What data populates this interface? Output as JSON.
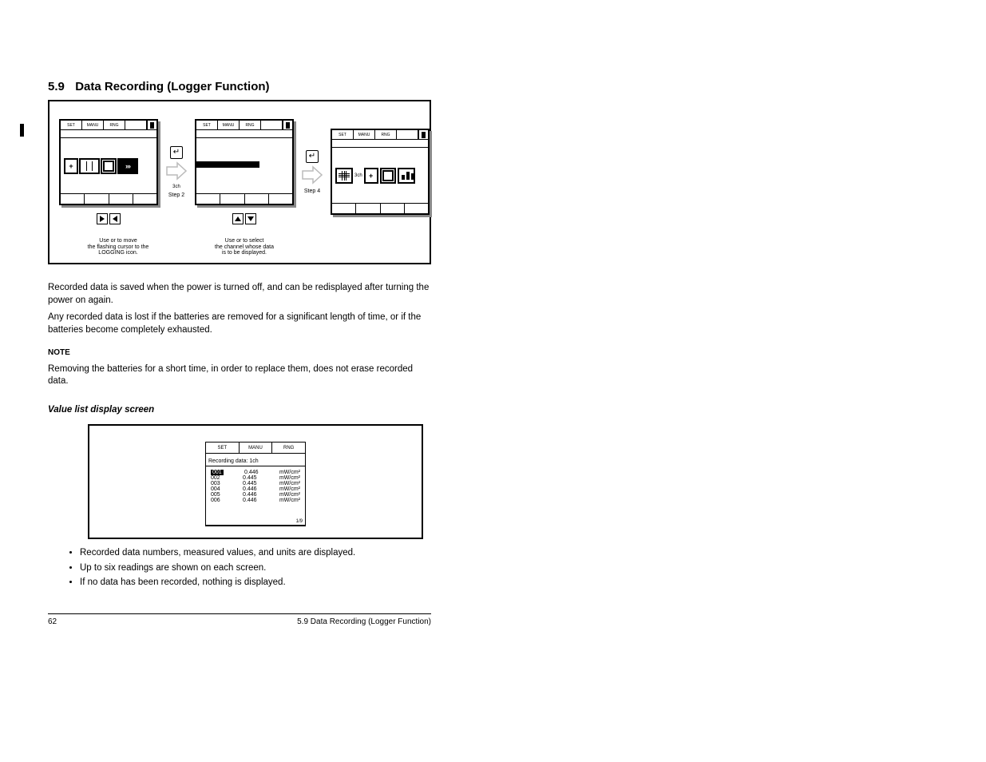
{
  "section_number": "5.9",
  "section_title": "Data Recording (Logger Function)",
  "diagram1": {
    "screen1": {
      "top_tabs": [
        "SET",
        "MANU",
        "RNG",
        ""
      ],
      "icons": {
        "plus": "+",
        "black_label": "›››"
      },
      "hint_lines": [
        "Use        or        to move",
        "the flashing cursor to the",
        "LOGGING icon."
      ]
    },
    "arrow1": {
      "key": "↵",
      "label": "3ch",
      "step": "Step 2"
    },
    "screen2": {
      "top_tabs": [
        "SET",
        "MANU",
        "RNG",
        ""
      ],
      "hint_lines": [
        "Use        or        to select",
        "the channel whose data",
        "is to be displayed."
      ]
    },
    "arrow2": {
      "key": "↵",
      "step": "Step 4"
    },
    "screen3": {
      "top_tabs": [
        "SET",
        "MANU",
        "RNG",
        ""
      ],
      "icons": {
        "plus": "+",
        "label_text": "3ch"
      }
    }
  },
  "paragraphs": {
    "p1": "Recorded data is saved when the power is turned off, and can be redisplayed after turning the power on again.",
    "p2": "Any recorded data is lost if the batteries are removed for a significant length of time, or if the batteries become completely exhausted.",
    "note_label": "NOTE",
    "p3": "Removing the batteries for a short time, in order to replace them, does not erase recorded data.",
    "sub": "Value list display screen"
  },
  "lcd2": {
    "title_tabs": [
      "SET",
      "MANU",
      "RNG"
    ],
    "title": "Recording data: 1ch",
    "rows": [
      {
        "n": "001",
        "v": "0.446",
        "u": "mW/cm²",
        "hl": true
      },
      {
        "n": "002",
        "v": "0.445",
        "u": "mW/cm²"
      },
      {
        "n": "003",
        "v": "0.445",
        "u": "mW/cm²"
      },
      {
        "n": "004",
        "v": "0.446",
        "u": "mW/cm²"
      },
      {
        "n": "005",
        "v": "0.446",
        "u": "mW/cm²"
      },
      {
        "n": "006",
        "v": "0.446",
        "u": "mW/cm²"
      }
    ],
    "pager": "1/9"
  },
  "bullets": [
    "Recorded data numbers, measured values, and units are displayed.",
    "Up to six readings are shown on each screen.",
    "If no data has been recorded, nothing is displayed."
  ],
  "footer": {
    "left": "62",
    "right": "5.9 Data Recording (Logger Function)"
  }
}
